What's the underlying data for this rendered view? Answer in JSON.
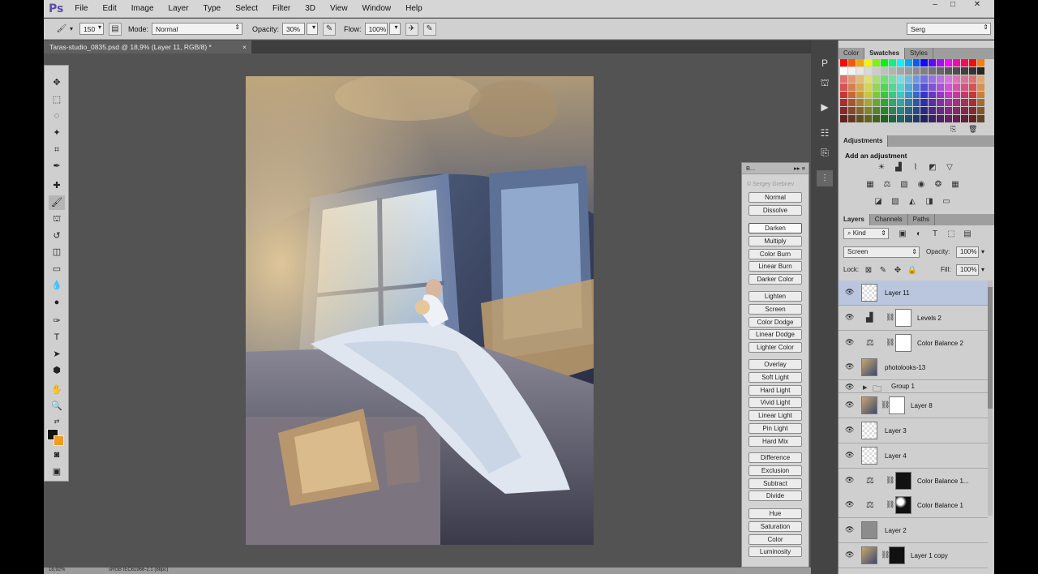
{
  "menubar": {
    "logo": "Ps",
    "items": [
      "File",
      "Edit",
      "Image",
      "Layer",
      "Type",
      "Select",
      "Filter",
      "3D",
      "View",
      "Window",
      "Help"
    ],
    "window_controls": [
      "–",
      "□",
      "✕"
    ]
  },
  "options": {
    "brush_size": "150",
    "mode_label": "Mode:",
    "mode_value": "Normal",
    "opacity_label": "Opacity:",
    "opacity_value": "30%",
    "flow_label": "Flow:",
    "flow_value": "100%",
    "workspace": "Serg"
  },
  "document": {
    "tab_title": "Taras-studio_0835.psd @ 18,9% (Layer 11, RGB/8) *",
    "close": "×",
    "zoom": "18,92%",
    "profile": "sRGB IEC61966-2.1 (8bpc)"
  },
  "swatches_panel": {
    "tabs": [
      "Color",
      "Swatches",
      "Styles"
    ],
    "active_tab": "Swatches"
  },
  "adjustments_panel": {
    "tab": "Adjustments",
    "title": "Add an adjustment"
  },
  "blend_panel": {
    "header": "B...",
    "watermark": "© Sergey Grebnev",
    "hover_mode": "Darken",
    "groups": [
      [
        "Normal",
        "Dissolve"
      ],
      [
        "Darken",
        "Multiply",
        "Color Burn",
        "Linear Burn",
        "Darker Color"
      ],
      [
        "Lighten",
        "Screen",
        "Color Dodge",
        "Linear Dodge",
        "Lighter Color"
      ],
      [
        "Overlay",
        "Soft Light",
        "Hard Light",
        "Vivid Light",
        "Linear Light",
        "Pin Light",
        "Hard Mix"
      ],
      [
        "Difference",
        "Exclusion",
        "Subtract",
        "Divide"
      ],
      [
        "Hue",
        "Saturation",
        "Color",
        "Luminosity"
      ]
    ]
  },
  "layers_panel": {
    "tabs": [
      "Layers",
      "Channels",
      "Paths"
    ],
    "active_tab": "Layers",
    "filter_kind": "Kind",
    "blend_mode": "Screen",
    "opacity_label": "Opacity:",
    "opacity_value": "100%",
    "lock_label": "Lock:",
    "fill_label": "Fill:",
    "fill_value": "100%",
    "layers": [
      {
        "name": "Layer 11",
        "kind": "pixel-empty",
        "selected": true
      },
      {
        "name": "Levels 2",
        "kind": "levels"
      },
      {
        "name": "Color Balance 2",
        "kind": "color-balance"
      },
      {
        "name": "photolooks-13",
        "kind": "photo"
      },
      {
        "name": "Group 1",
        "kind": "group"
      },
      {
        "name": "Layer 8",
        "kind": "photo-mask"
      },
      {
        "name": "Layer 3",
        "kind": "pixel-empty"
      },
      {
        "name": "Layer 4",
        "kind": "pixel-empty"
      },
      {
        "name": "Color Balance 1...",
        "kind": "color-balance-dark"
      },
      {
        "name": "Color Balance 1",
        "kind": "color-balance-spots"
      },
      {
        "name": "Layer 2",
        "kind": "gray"
      },
      {
        "name": "Layer 1 copy",
        "kind": "photo-dark-mask"
      }
    ]
  },
  "colors": {
    "foreground": "#111111",
    "background": "#f29a21",
    "selected_layer": "#b9c6de"
  }
}
